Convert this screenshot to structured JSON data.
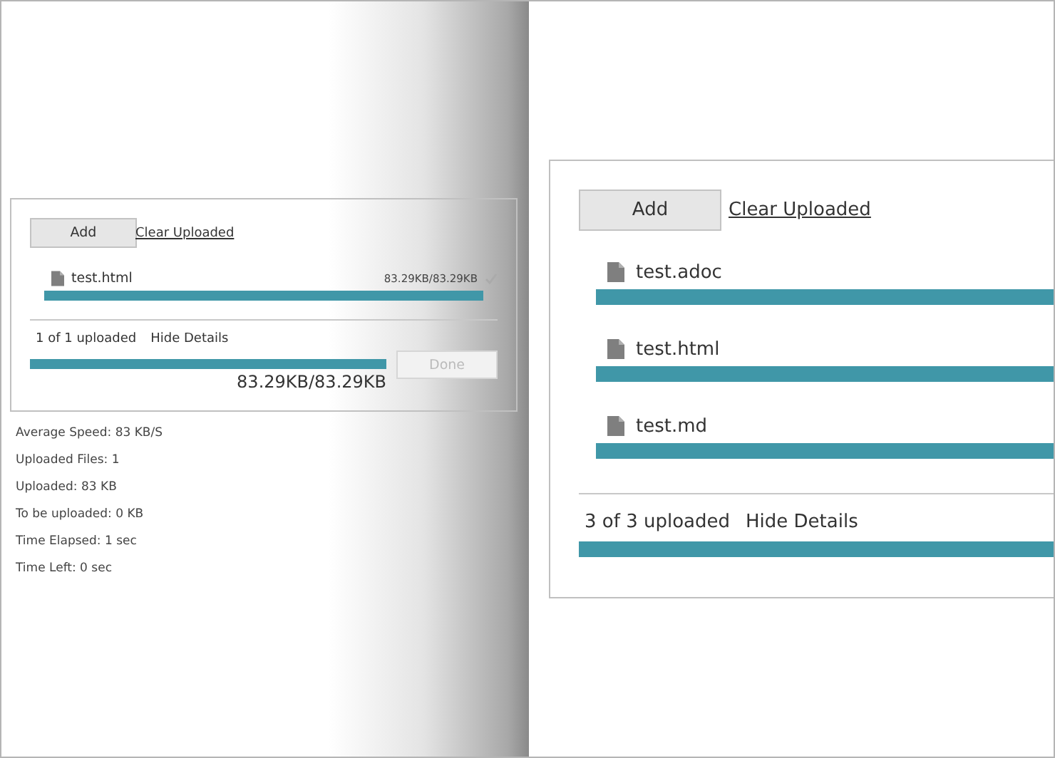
{
  "small_uploader": {
    "add_button": "Add",
    "clear_link": "Clear Uploaded",
    "files": [
      {
        "name": "test.html",
        "size": "83.29KB/83.29KB",
        "completed": true,
        "level": 1
      }
    ],
    "summary": "1 of 1 uploaded",
    "details_link": "Hide Details",
    "total_progress": {
      "level": 1
    },
    "total_size": "83.29KB/83.29KB",
    "done_button": {
      "label": "Done",
      "disabled": true
    },
    "details": [
      "Average Speed: 83 KB/S",
      "Uploaded Files: 1",
      "Uploaded: 83 KB",
      "To be uploaded: 0 KB",
      "Time Elapsed: 1 sec",
      "Time Left: 0 sec"
    ]
  },
  "large_uploader": {
    "add_button": "Add",
    "clear_link": "Clear Uploaded",
    "files": [
      {
        "name": "test.adoc",
        "level": 1
      },
      {
        "name": "test.html",
        "level": 1
      },
      {
        "name": "test.md",
        "level": 1
      }
    ],
    "summary": "3 of 3 uploaded",
    "details_link": "Hide Details",
    "total_progress": {
      "level": 1
    }
  }
}
